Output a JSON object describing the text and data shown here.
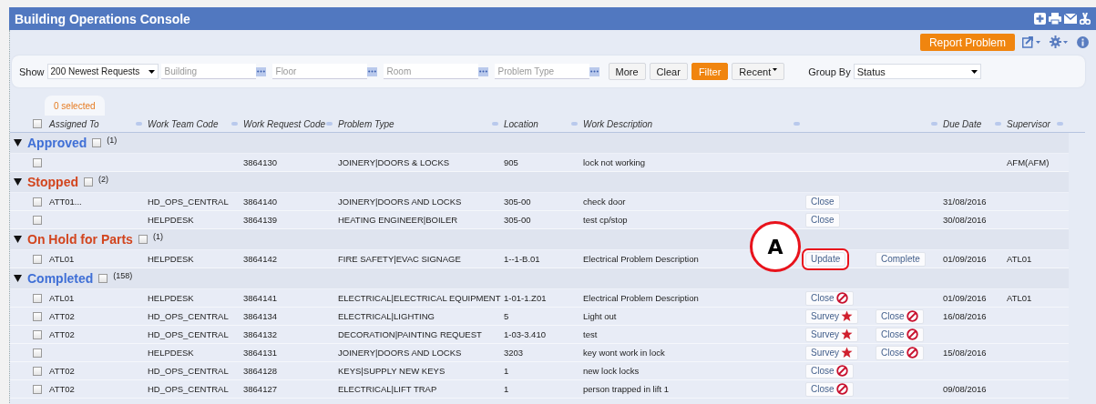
{
  "window": {
    "title": "Building Operations Console"
  },
  "toolbar": {
    "report_button": "Report Problem"
  },
  "filter": {
    "show_label": "Show",
    "show_value": "200 Newest Requests",
    "fields": [
      {
        "placeholder": "Building"
      },
      {
        "placeholder": "Floor"
      },
      {
        "placeholder": "Room"
      },
      {
        "placeholder": "Problem Type"
      }
    ],
    "buttons": [
      {
        "label": "More",
        "kind": "plain"
      },
      {
        "label": "Clear",
        "kind": "plain"
      },
      {
        "label": "Filter",
        "kind": "primary"
      },
      {
        "label": "Recent",
        "kind": "menu"
      }
    ],
    "group_by_label": "Group By",
    "group_by_value": "Status"
  },
  "selection_tab": "0 selected",
  "table": {
    "select_all_checked": false,
    "columns": [
      "Assigned To",
      "Work Team Code",
      "Work Request Code",
      "Problem Type",
      "Location",
      "Work Description",
      "Due Date",
      "Supervisor"
    ],
    "groups": [
      {
        "label": "Approved",
        "color": "#3f6fd6",
        "count": "(1)",
        "checked": false,
        "expanded": true,
        "rows": [
          {
            "checked": false,
            "assigned": "",
            "team": "",
            "code": "3864130",
            "problem": "JOINERY|DOORS & LOCKS",
            "location": "905",
            "description": "lock not working",
            "actions": [],
            "due": "",
            "supervisor": "AFM(AFM)"
          }
        ]
      },
      {
        "label": "Stopped",
        "color": "#d2451e",
        "count": "(2)",
        "checked": false,
        "expanded": true,
        "rows": [
          {
            "checked": false,
            "assigned": "ATT01...",
            "team": "HD_OPS_CENTRAL",
            "code": "3864140",
            "problem": "JOINERY|DOORS AND LOCKS",
            "location": "305-00",
            "description": "check door",
            "actions": [
              {
                "label": "Close",
                "kind": "plain",
                "highlighted": false
              }
            ],
            "due": "31/08/2016",
            "supervisor": ""
          },
          {
            "checked": false,
            "assigned": "",
            "team": "HELPDESK",
            "code": "3864139",
            "problem": "HEATING ENGINEER|BOILER",
            "location": "305-00",
            "description": "test cp/stop",
            "actions": [
              {
                "label": "Close",
                "kind": "plain",
                "highlighted": false
              }
            ],
            "due": "30/08/2016",
            "supervisor": ""
          }
        ]
      },
      {
        "label": "On Hold for Parts",
        "color": "#d2451e",
        "count": "(1)",
        "checked": false,
        "expanded": true,
        "rows": [
          {
            "checked": false,
            "assigned": "ATL01",
            "team": "HELPDESK",
            "code": "3864142",
            "problem": "FIRE SAFETY|EVAC SIGNAGE",
            "location": "1--1-B.01",
            "description": "Electrical Problem Description",
            "actions": [
              {
                "label": "Update",
                "kind": "plain",
                "highlighted": true
              },
              {
                "label": "Complete",
                "kind": "plain",
                "highlighted": false
              }
            ],
            "due": "01/09/2016",
            "supervisor": "ATL01"
          }
        ]
      },
      {
        "label": "Completed",
        "color": "#3f6fd6",
        "count": "(158)",
        "checked": false,
        "expanded": true,
        "rows": [
          {
            "checked": false,
            "assigned": "ATL01",
            "team": "HELPDESK",
            "code": "3864141",
            "problem": "ELECTRICAL|ELECTRICAL EQUIPMENT",
            "location": "1-01-1.Z01",
            "description": "Electrical Problem Description",
            "actions": [
              {
                "label": "Close",
                "kind": "close",
                "highlighted": false
              }
            ],
            "due": "01/09/2016",
            "supervisor": "ATL01"
          },
          {
            "checked": false,
            "assigned": "ATT02",
            "team": "HD_OPS_CENTRAL",
            "code": "3864134",
            "problem": "ELECTRICAL|LIGHTING",
            "location": "5",
            "description": "Light out",
            "actions": [
              {
                "label": "Survey",
                "kind": "survey",
                "highlighted": false
              },
              {
                "label": "Close",
                "kind": "close",
                "highlighted": false
              }
            ],
            "due": "16/08/2016",
            "supervisor": ""
          },
          {
            "checked": false,
            "assigned": "ATT02",
            "team": "HD_OPS_CENTRAL",
            "code": "3864132",
            "problem": "DECORATION|PAINTING REQUEST",
            "location": "1-03-3.410",
            "description": "test",
            "actions": [
              {
                "label": "Survey",
                "kind": "survey",
                "highlighted": false
              },
              {
                "label": "Close",
                "kind": "close",
                "highlighted": false
              }
            ],
            "due": "",
            "supervisor": ""
          },
          {
            "checked": false,
            "assigned": "",
            "team": "HELPDESK",
            "code": "3864131",
            "problem": "JOINERY|DOORS AND LOCKS",
            "location": "3203",
            "description": "key wont work in lock",
            "actions": [
              {
                "label": "Survey",
                "kind": "survey",
                "highlighted": false
              },
              {
                "label": "Close",
                "kind": "close",
                "highlighted": false
              }
            ],
            "due": "15/08/2016",
            "supervisor": ""
          },
          {
            "checked": false,
            "assigned": "ATT02",
            "team": "HD_OPS_CENTRAL",
            "code": "3864128",
            "problem": "KEYS|SUPPLY NEW KEYS",
            "location": "1",
            "description": "new lock locks",
            "actions": [
              {
                "label": "Close",
                "kind": "close",
                "highlighted": false
              }
            ],
            "due": "",
            "supervisor": ""
          },
          {
            "checked": false,
            "assigned": "ATT02",
            "team": "HD_OPS_CENTRAL",
            "code": "3864127",
            "problem": "ELECTRICAL|LIFT TRAP",
            "location": "1",
            "description": "person trapped in lift 1",
            "actions": [
              {
                "label": "Close",
                "kind": "close",
                "highlighted": false
              }
            ],
            "due": "09/08/2016",
            "supervisor": ""
          }
        ]
      }
    ]
  },
  "callout": {
    "label": "A"
  }
}
